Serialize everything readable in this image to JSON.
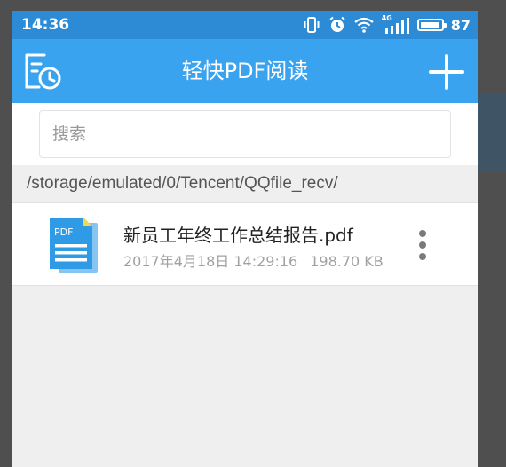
{
  "status_bar": {
    "time": "14:36",
    "battery_level": "87",
    "network_label": "4G",
    "icons": [
      "vibrate-icon",
      "alarm-icon",
      "wifi-icon",
      "signal-icon",
      "battery-icon"
    ]
  },
  "app_bar": {
    "title": "轻快PDF阅读",
    "left_icon": "history-icon",
    "right_icon": "plus-icon"
  },
  "search": {
    "value": "",
    "placeholder": "搜索"
  },
  "path": {
    "current": "/storage/emulated/0/Tencent/QQfile_recv/"
  },
  "files": [
    {
      "icon": "pdf-file-icon",
      "icon_label": "PDF",
      "name": "新员工年终工作总结报告.pdf",
      "date": "2017年4月18日 14:29:16",
      "size": "198.70 KB"
    }
  ],
  "colors": {
    "status_bar": "#2d8bd6",
    "app_bar": "#3aa3ef",
    "file_icon": "#2f9ae6",
    "file_icon_corner": "#f2d94a"
  }
}
